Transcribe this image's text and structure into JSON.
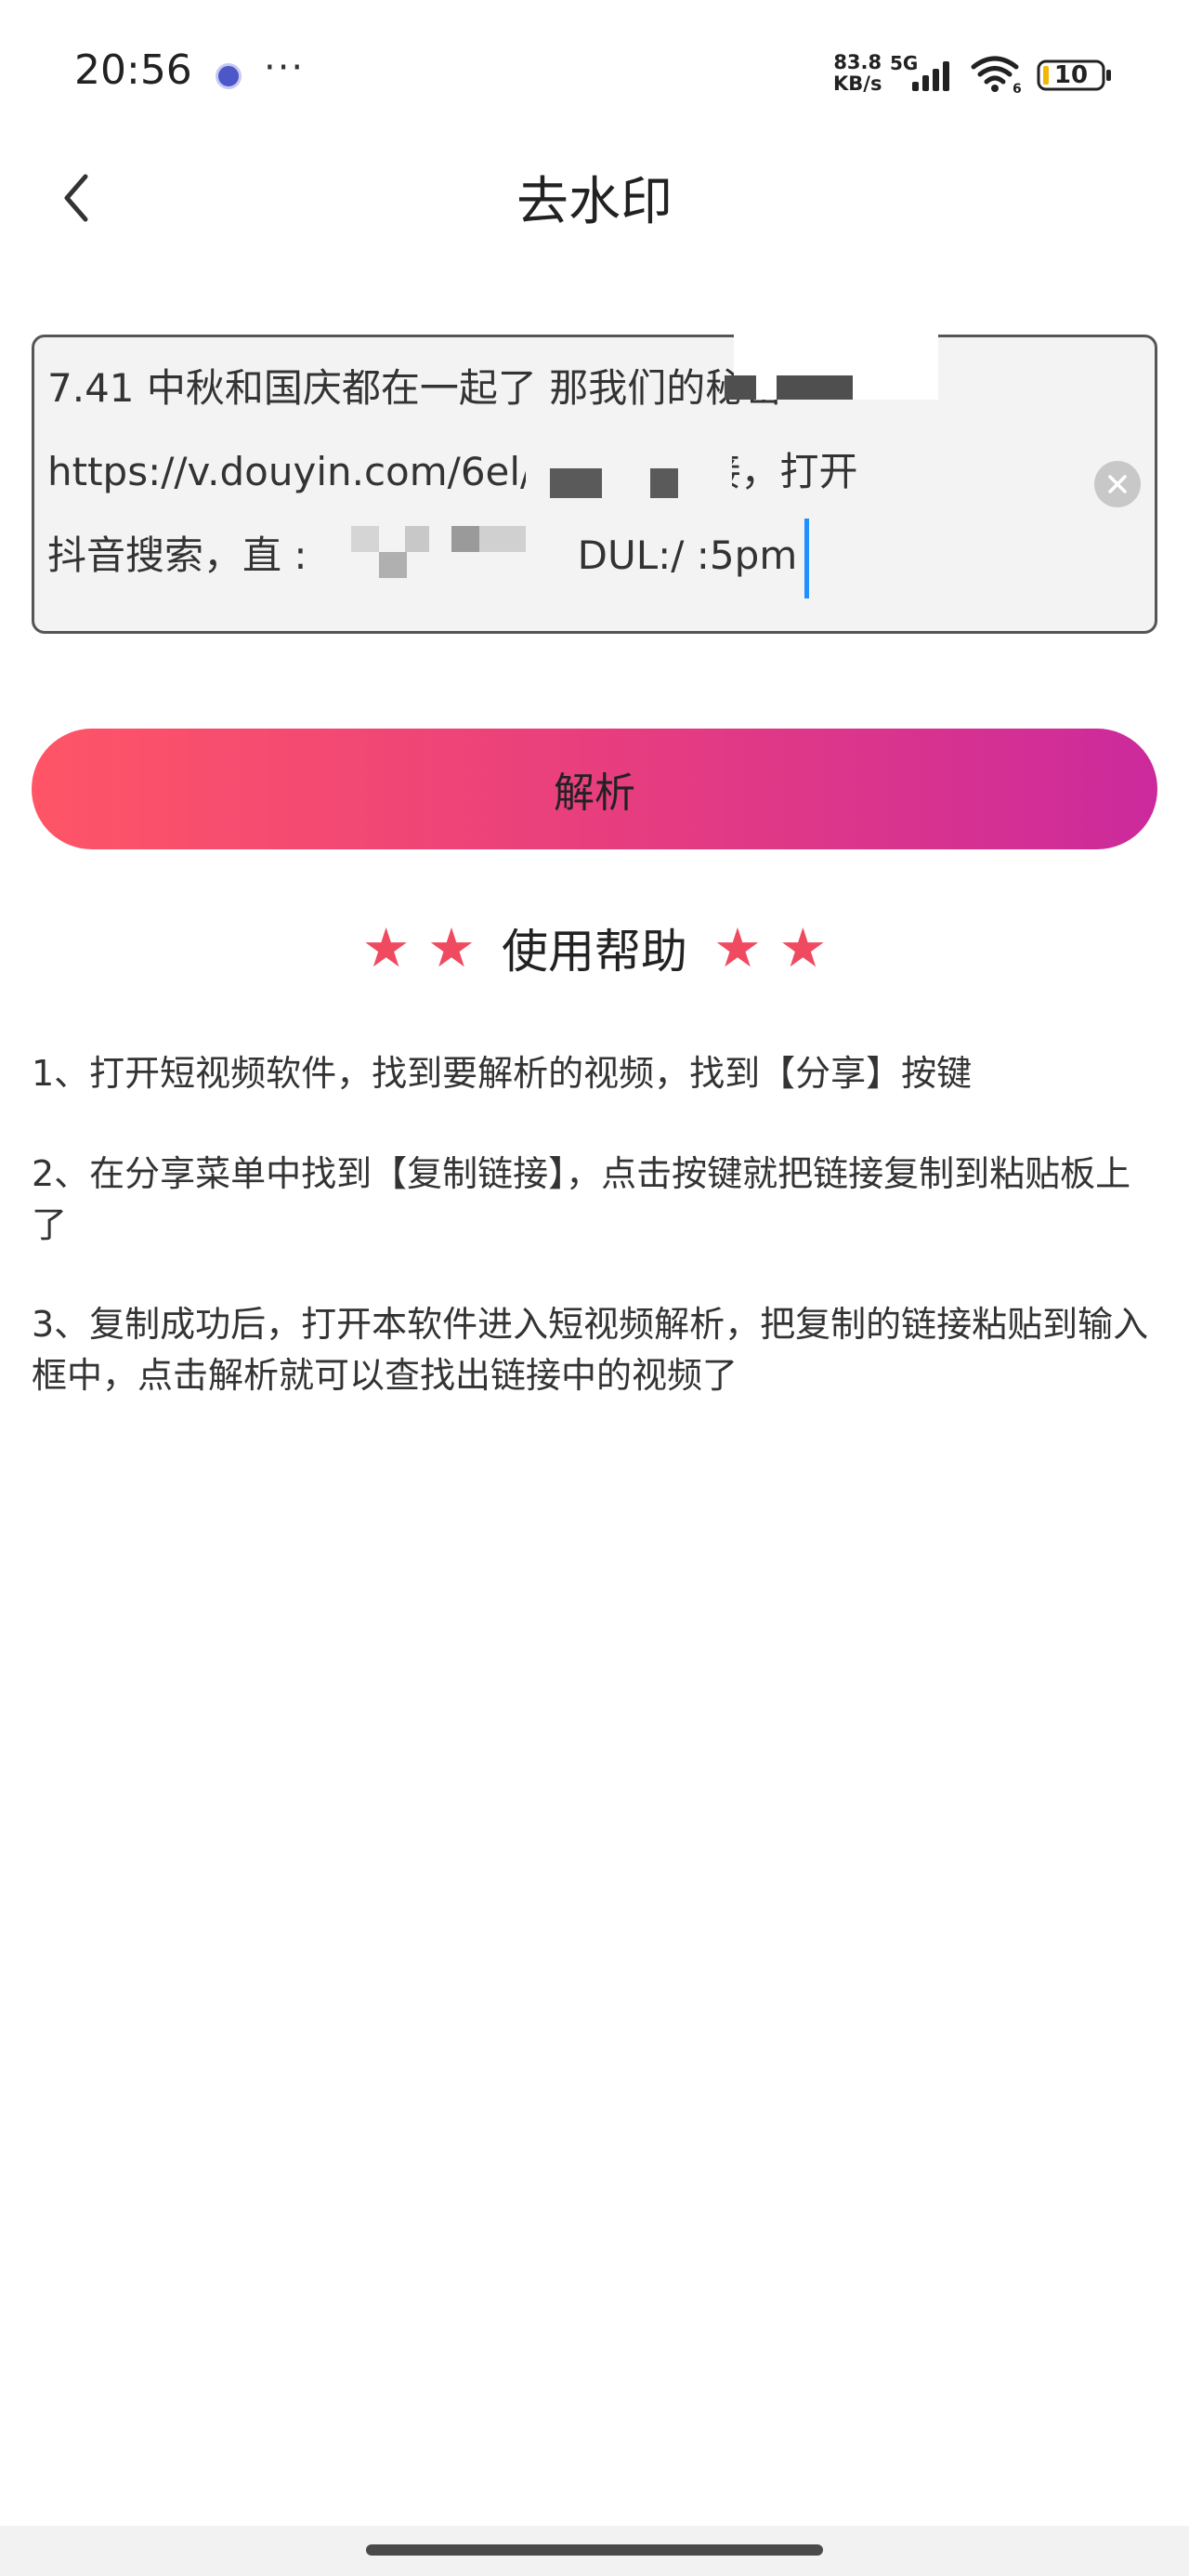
{
  "status_bar": {
    "time": "20:56",
    "more": "···",
    "speed_value": "83.8",
    "speed_unit": "KB/s",
    "network_type": "5G",
    "wifi_badge": "6",
    "battery_level": "10"
  },
  "header": {
    "title": "去水印"
  },
  "link_input": {
    "value": "7.41 中秋和国庆都在一起了 那我们的秘密\nhttps://v.douyin.com/6el/ 复制此链接，打开\n抖音搜索，直 : l@v.fb 12/11 DUL:/ :5pm"
  },
  "parse_button": {
    "label": "解析"
  },
  "help": {
    "stars_left": "★ ★",
    "title": "使用帮助",
    "stars_right": "★ ★",
    "items": [
      "1、打开短视频软件，找到要解析的视频，找到【分享】按键",
      "2、在分享菜单中找到【复制链接】，点击按键就把链接复制到粘贴板上了",
      "3、复制成功后，打开本软件进入短视频解析，把复制的链接粘贴到输入框中，点击解析就可以查找出链接中的视频了"
    ]
  },
  "colors": {
    "accent_start": "#ff5566",
    "accent_end": "#cc2a9c",
    "star": "#f04a60",
    "caret": "#1e90ff"
  },
  "icons": {
    "back": "chevron-left-icon",
    "clear": "close-circle-icon",
    "signal": "cellular-signal-icon",
    "wifi": "wifi-icon",
    "battery": "battery-icon"
  }
}
